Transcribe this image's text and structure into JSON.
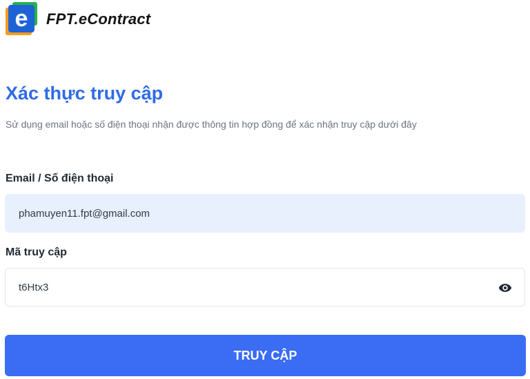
{
  "brand": {
    "name": "FPT.eContract",
    "logo_icon": "fpt-e-logo",
    "logo_letter": "e"
  },
  "page": {
    "title": "Xác thực truy cập",
    "subtitle": "Sử dụng email hoặc số điện thoại nhận được thông tin hợp đồng để xác nhận truy cập dưới đây"
  },
  "form": {
    "email_label": "Email / Số điện thoại",
    "email_value": "phamuyen11.fpt@gmail.com",
    "code_label": "Mã truy cập",
    "code_value": "t6Htx3",
    "toggle_icon": "eye-icon",
    "submit_label": "TRUY CẬP"
  },
  "colors": {
    "title": "#2e6be6",
    "button": "#3a6cf4",
    "email_field_bg": "#e8f0fe"
  }
}
